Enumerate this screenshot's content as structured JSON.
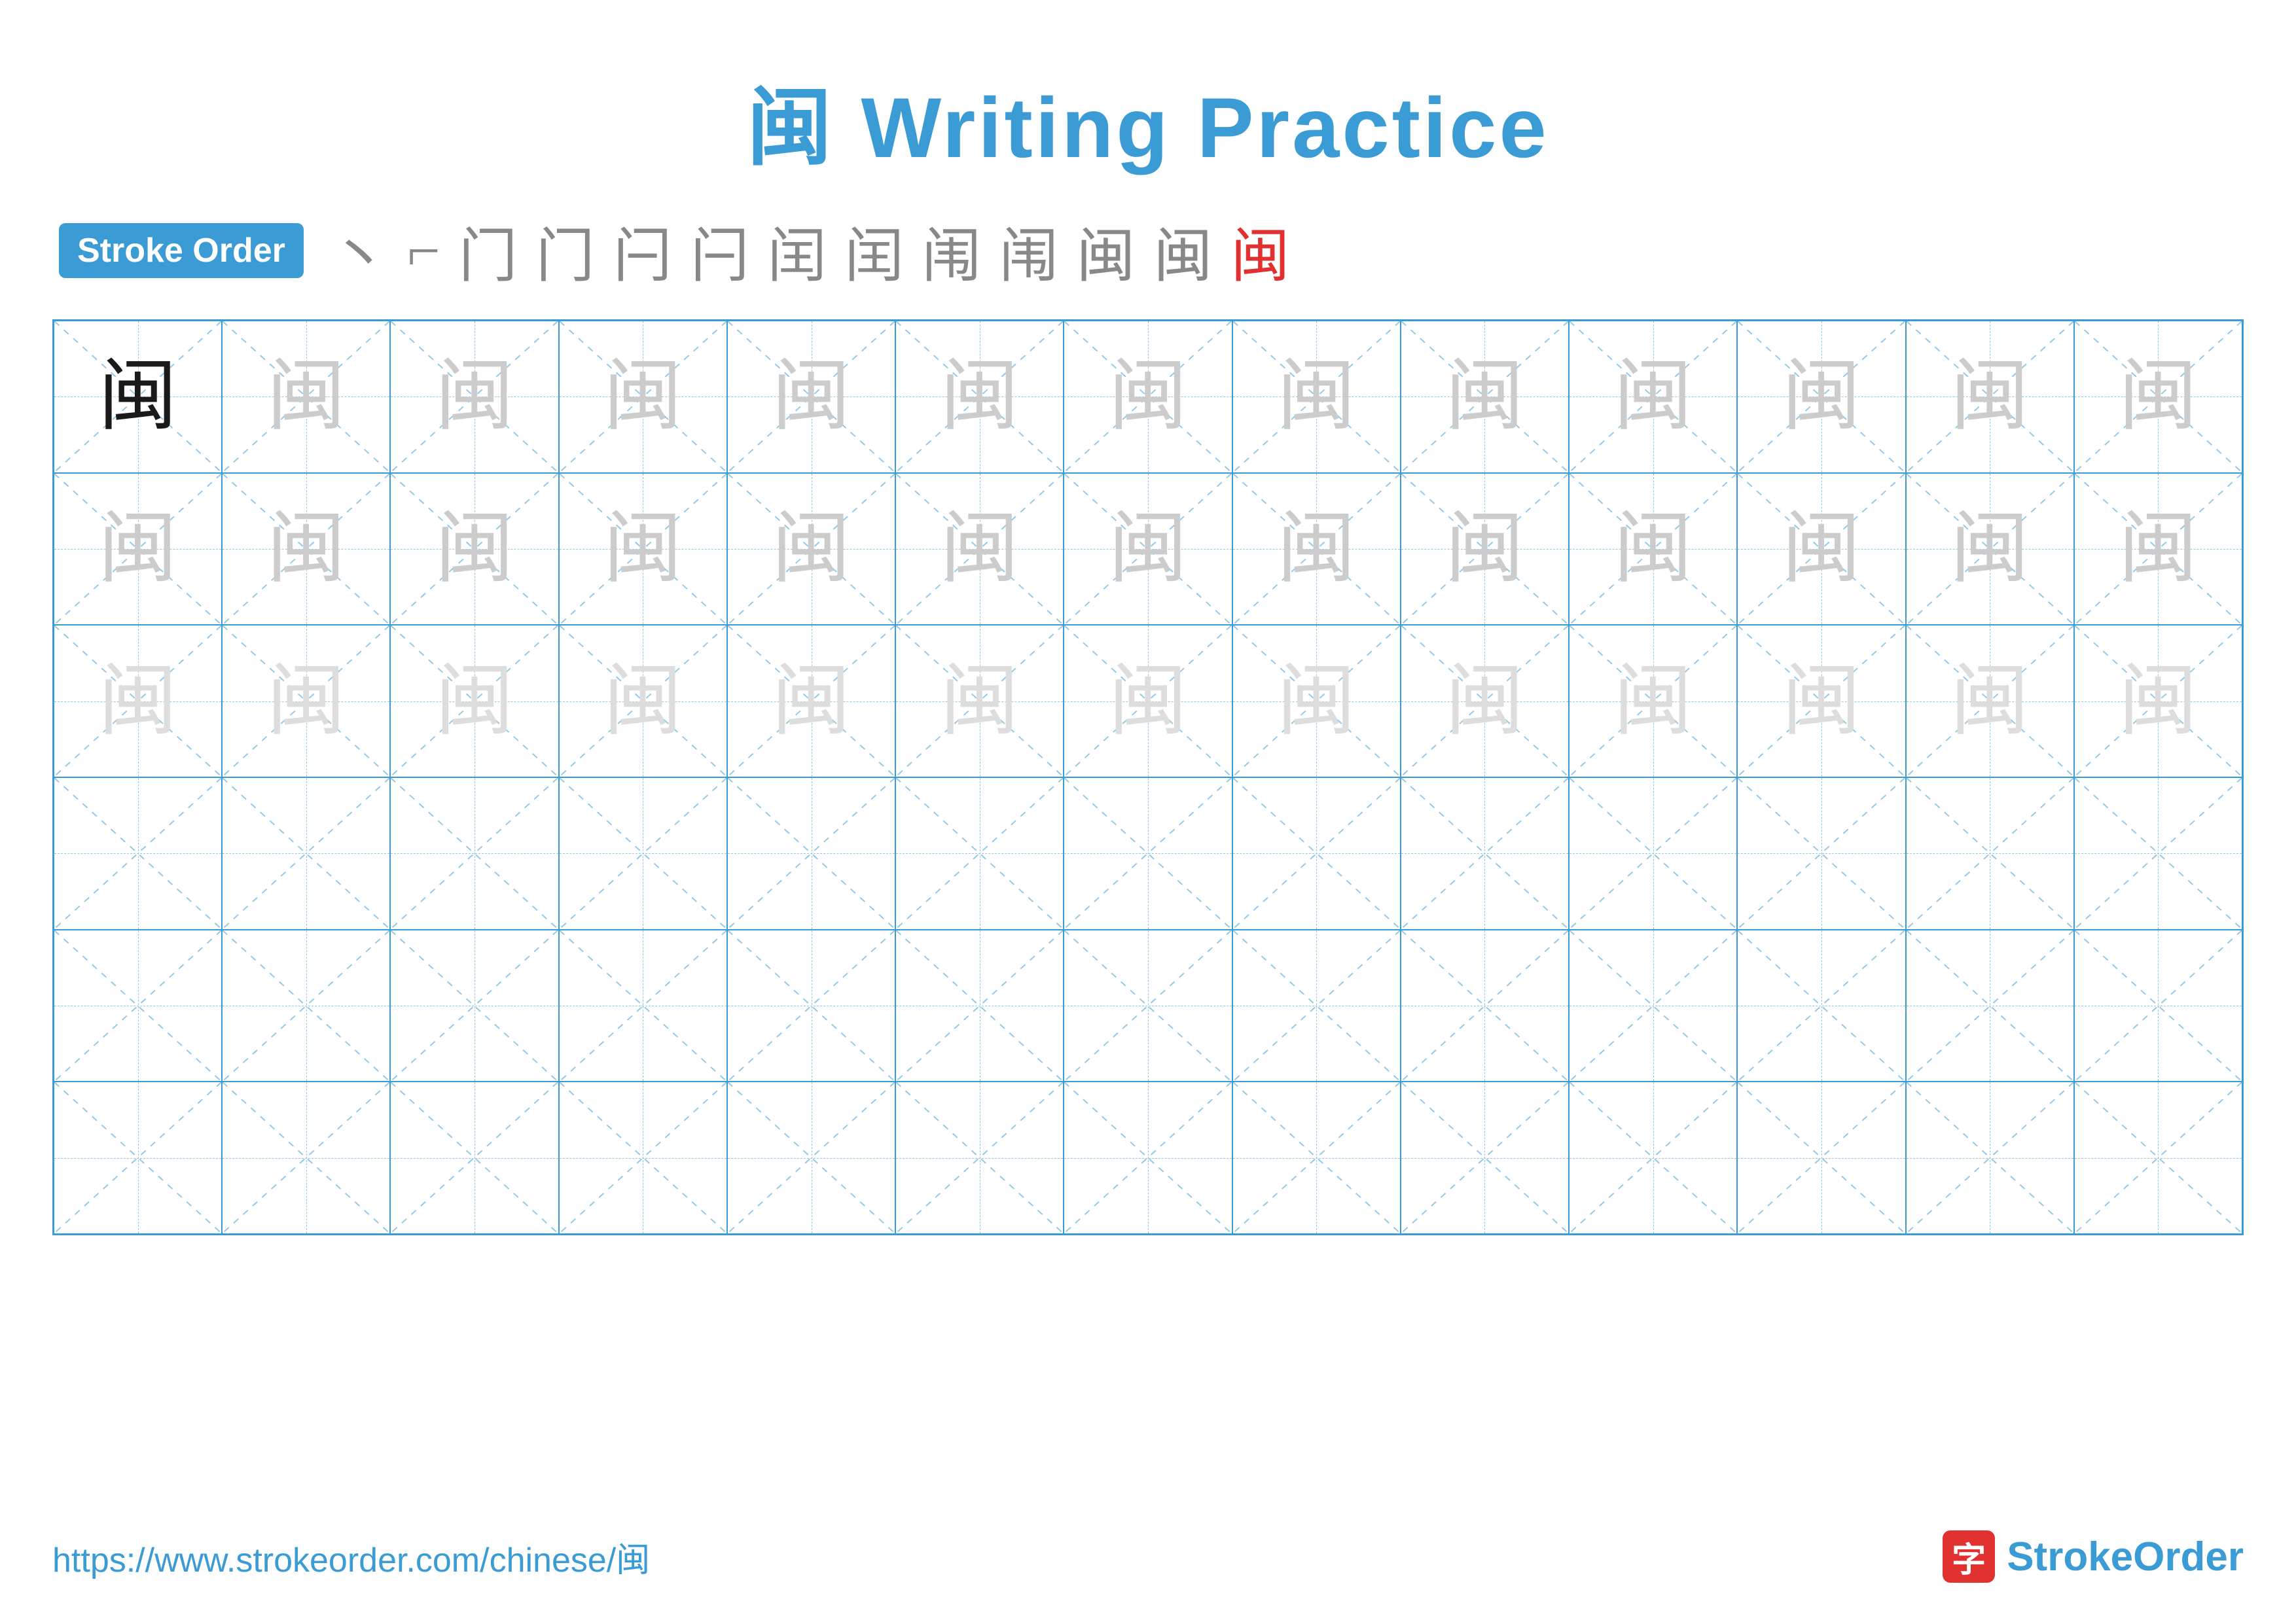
{
  "title": {
    "char": "闽",
    "label": "Writing Practice",
    "full": "闽 Writing Practice"
  },
  "stroke_order": {
    "badge_label": "Stroke Order",
    "strokes": [
      {
        "char": "丶",
        "type": "gray"
      },
      {
        "char": "𠄌",
        "type": "gray"
      },
      {
        "char": "门",
        "type": "gray"
      },
      {
        "char": "门",
        "type": "gray"
      },
      {
        "char": "闩",
        "type": "gray"
      },
      {
        "char": "闩",
        "type": "gray"
      },
      {
        "char": "闰",
        "type": "gray"
      },
      {
        "char": "闰",
        "type": "gray"
      },
      {
        "char": "闱",
        "type": "gray"
      },
      {
        "char": "闱",
        "type": "gray"
      },
      {
        "char": "闽",
        "type": "gray"
      },
      {
        "char": "闽",
        "type": "gray"
      },
      {
        "char": "闽",
        "type": "red"
      }
    ]
  },
  "grid": {
    "rows": 6,
    "cols": 13,
    "character": "闽",
    "row_types": [
      "solid_then_light",
      "light",
      "lighter",
      "empty",
      "empty",
      "empty"
    ]
  },
  "footer": {
    "url": "https://www.strokeorder.com/chinese/闽",
    "logo_icon": "字",
    "logo_text": "StrokeOrder"
  },
  "colors": {
    "blue": "#3a9bd5",
    "red": "#e03030",
    "gray_stroke": "#888888",
    "light_char": "#cccccc",
    "lighter_char": "#dddddd",
    "grid_line": "#3a9bd5",
    "grid_dashed": "#90c8e8"
  }
}
